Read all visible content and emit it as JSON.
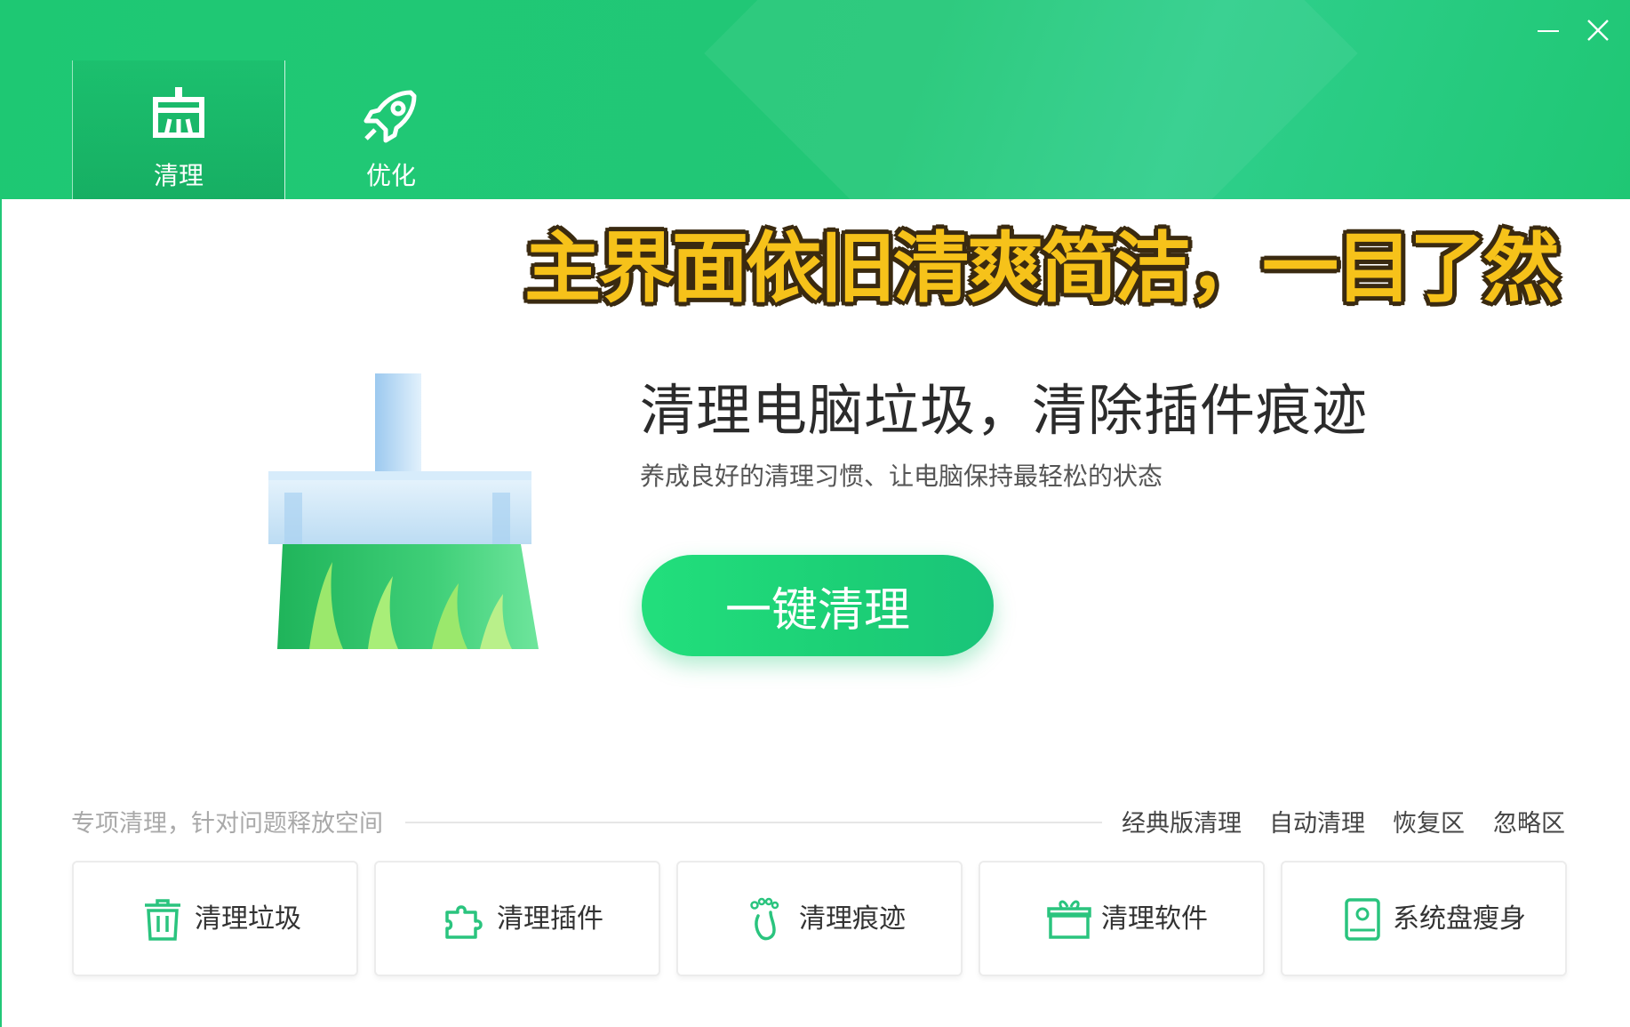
{
  "window": {
    "minimize_icon": "minimize-icon",
    "close_icon": "close-icon"
  },
  "tabs": [
    {
      "label": "清理",
      "icon": "broom-icon",
      "active": true
    },
    {
      "label": "优化",
      "icon": "rocket-icon",
      "active": false
    }
  ],
  "banner": "主界面依旧清爽简洁，一目了然",
  "hero": {
    "title": "清理电脑垃圾，清除插件痕迹",
    "subtitle": "养成良好的清理习惯、让电脑保持最轻松的状态",
    "button_label": "一键清理",
    "illustration": "broom-illustration"
  },
  "section": {
    "label": "专项清理，针对问题释放空间",
    "links": [
      "经典版清理",
      "自动清理",
      "恢复区",
      "忽略区"
    ]
  },
  "cards": [
    {
      "label": "清理垃圾",
      "icon": "trash-icon"
    },
    {
      "label": "清理插件",
      "icon": "puzzle-icon"
    },
    {
      "label": "清理痕迹",
      "icon": "footprint-icon"
    },
    {
      "label": "清理软件",
      "icon": "gift-box-icon"
    },
    {
      "label": "系统盘瘦身",
      "icon": "disk-icon"
    }
  ],
  "colors": {
    "brand_green": "#22c777",
    "button_green": "#1ccf76",
    "banner_yellow": "#f6c21a",
    "icon_green": "#2ac47e"
  }
}
